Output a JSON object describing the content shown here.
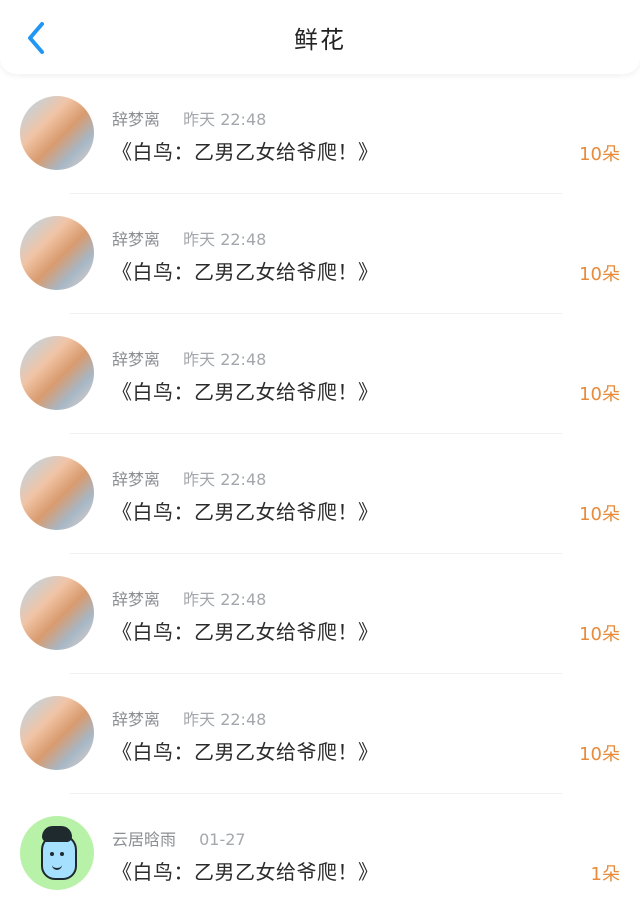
{
  "header": {
    "title": "鲜花",
    "back_icon": "chevron-left-icon",
    "accent_color": "#2196f3"
  },
  "list": {
    "items": [
      {
        "name": "辞梦离",
        "time": "昨天 22:48",
        "title": "《白鸟：乙男乙女给爷爬！》",
        "count": "10朵"
      },
      {
        "name": "辞梦离",
        "time": "昨天 22:48",
        "title": "《白鸟：乙男乙女给爷爬！》",
        "count": "10朵"
      },
      {
        "name": "辞梦离",
        "time": "昨天 22:48",
        "title": "《白鸟：乙男乙女给爷爬！》",
        "count": "10朵"
      },
      {
        "name": "辞梦离",
        "time": "昨天 22:48",
        "title": "《白鸟：乙男乙女给爷爬！》",
        "count": "10朵"
      },
      {
        "name": "辞梦离",
        "time": "昨天 22:48",
        "title": "《白鸟：乙男乙女给爷爬！》",
        "count": "10朵"
      },
      {
        "name": "辞梦离",
        "time": "昨天 22:48",
        "title": "《白鸟：乙男乙女给爷爬！》",
        "count": "10朵"
      },
      {
        "name": "云居晗雨",
        "time": "01-27",
        "title": "《白鸟：乙男乙女给爷爬！》",
        "count": "1朵"
      }
    ]
  },
  "colors": {
    "count": "#e78b3b",
    "meta": "#8b8f94"
  }
}
